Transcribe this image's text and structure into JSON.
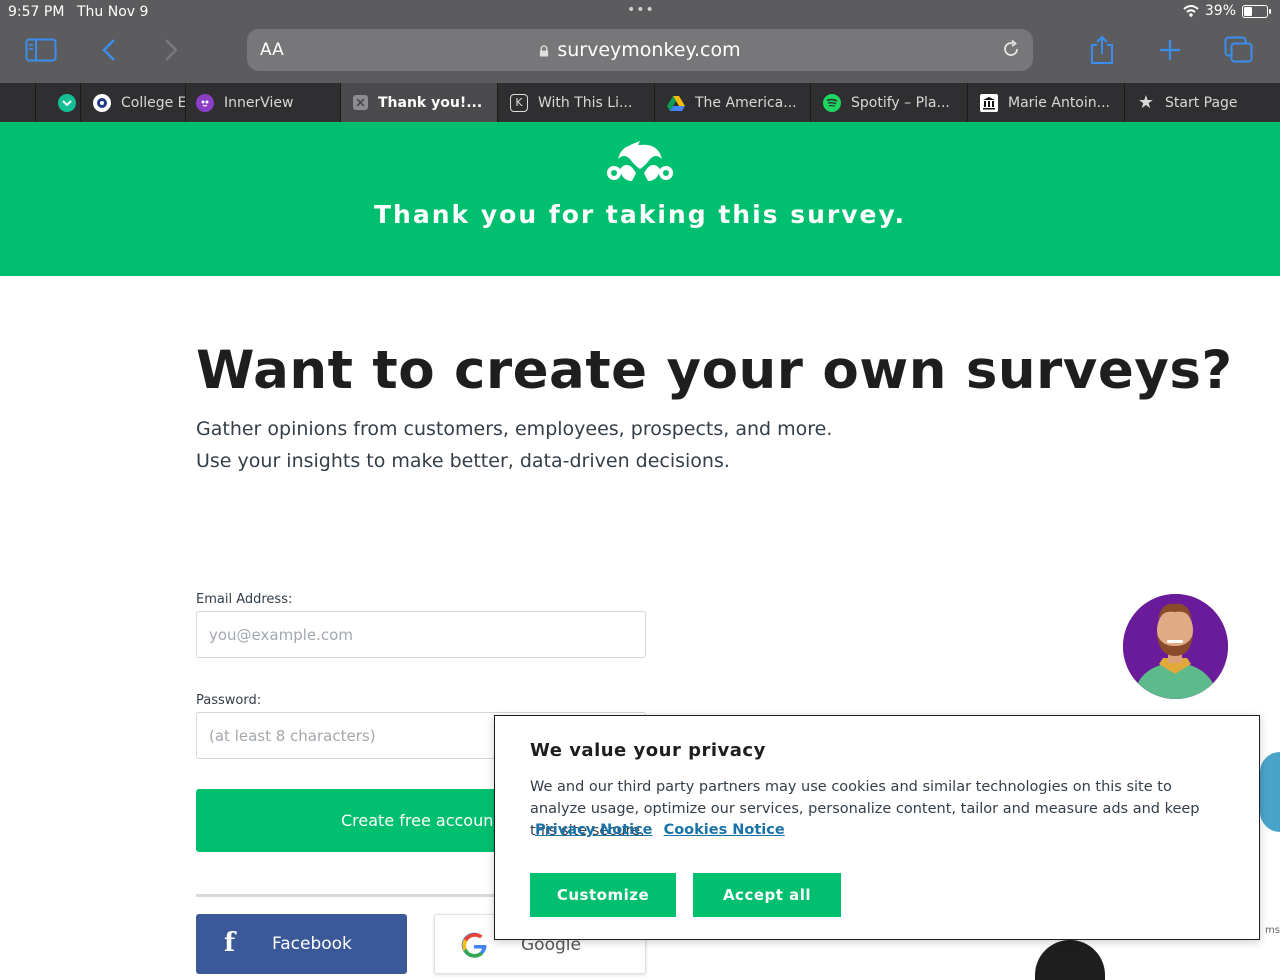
{
  "status_bar": {
    "time": "9:57 PM",
    "date": "Thu Nov 9",
    "battery": "39%",
    "battery_level": 0.39
  },
  "browser": {
    "text_size_label": "AA",
    "url": "surveymonkey.com",
    "tabs": [
      {
        "label": "College E",
        "icon": "circle-logo-icon"
      },
      {
        "label": "InnerView",
        "icon": "innerview-logo-icon"
      },
      {
        "label": "Thank you!...",
        "icon": "close-tab-icon",
        "active": true
      },
      {
        "label": "With This Li...",
        "icon": "k-logo-icon"
      },
      {
        "label": "The America...",
        "icon": "google-drive-icon"
      },
      {
        "label": "Spotify – Pla...",
        "icon": "spotify-icon"
      },
      {
        "label": "Marie Antoin...",
        "icon": "museum-icon"
      },
      {
        "label": "Start Page",
        "icon": "star-icon"
      }
    ]
  },
  "banner": {
    "title": "Thank you for taking this survey.",
    "color": "#00bf6f"
  },
  "main": {
    "headline": "Want to create your own surveys?",
    "subtitle_line1": "Gather opinions from customers, employees, prospects, and more.",
    "subtitle_line2": "Use your insights to make better, data-driven decisions.",
    "email_label": "Email Address:",
    "email_placeholder": "you@example.com",
    "password_label": "Password:",
    "password_placeholder": "(at least 8 characters)",
    "create_button": "Create free account",
    "facebook_button": "Facebook",
    "google_button": "Google"
  },
  "cookie_banner": {
    "title": "We value your privacy",
    "body": "We and our third party partners may use cookies and similar technologies on this site to analyze usage, optimize our services, personalize content, tailor and measure ads and keep this site secure.",
    "privacy_link": "Privacy Notice",
    "cookies_link": "Cookies Notice",
    "customize_button": "Customize",
    "accept_button": "Accept all"
  },
  "corner_text": "ms"
}
